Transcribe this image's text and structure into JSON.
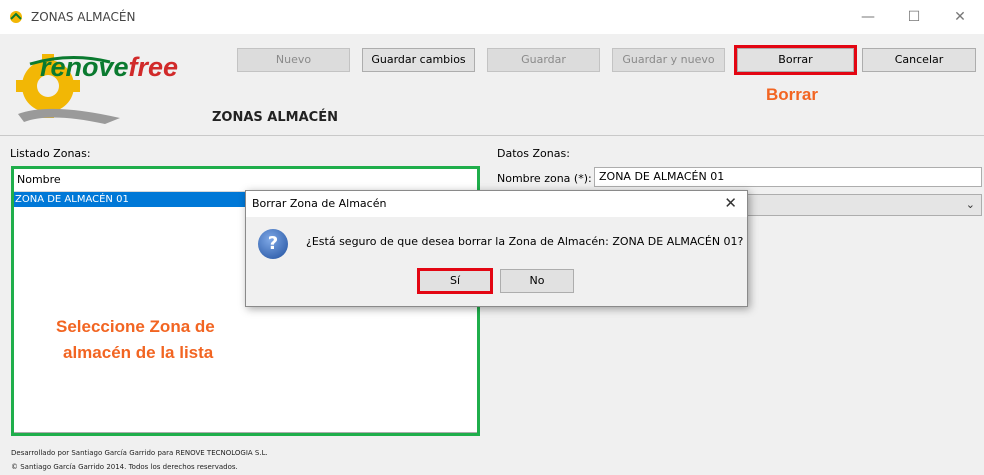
{
  "window": {
    "title": "ZONAS ALMACÉN",
    "minimize": "—",
    "maximize": "☐",
    "close": "✕"
  },
  "logo": {
    "text": "renovefree",
    "colors": {
      "primary": "#0a7a2f",
      "accent": "#f2b705"
    }
  },
  "toolbar": {
    "nuevo": "Nuevo",
    "guardar_cambios": "Guardar cambios",
    "guardar": "Guardar",
    "guardar_y_nuevo": "Guardar y nuevo",
    "borrar": "Borrar",
    "cancelar": "Cancelar"
  },
  "annotations": {
    "borrar_callout": "Borrar",
    "seleccione_line1": "Seleccione Zona de",
    "seleccione_line2": "almacén de la lista",
    "highlight_red": "#e30613",
    "highlight_green": "#1fae4b",
    "callout_color": "#f26522"
  },
  "page_heading": "ZONAS ALMACÉN",
  "list": {
    "label": "Listado Zonas:",
    "header": "Nombre",
    "rows": [
      "ZONA DE ALMACÉN 01"
    ],
    "selected_color": "#0078d7"
  },
  "details": {
    "label": "Datos Zonas:",
    "nombre_label": "Nombre zona (*):",
    "nombre_value": "ZONA DE ALMACÉN 01",
    "combo_chevron": "chevron-down-icon"
  },
  "dialog": {
    "title": "Borrar Zona de Almacén",
    "close": "✕",
    "icon": "question-icon",
    "message": "¿Está seguro de que desea borrar la Zona de Almacén: ZONA DE ALMACÉN 01?",
    "yes": "Sí",
    "no": "No"
  },
  "footer": {
    "line1": "Desarrollado por Santiago García Garrido para RENOVE TECNOLOGIA S.L.",
    "line2": "© Santiago García Garrido 2014. Todos los derechos reservados."
  }
}
